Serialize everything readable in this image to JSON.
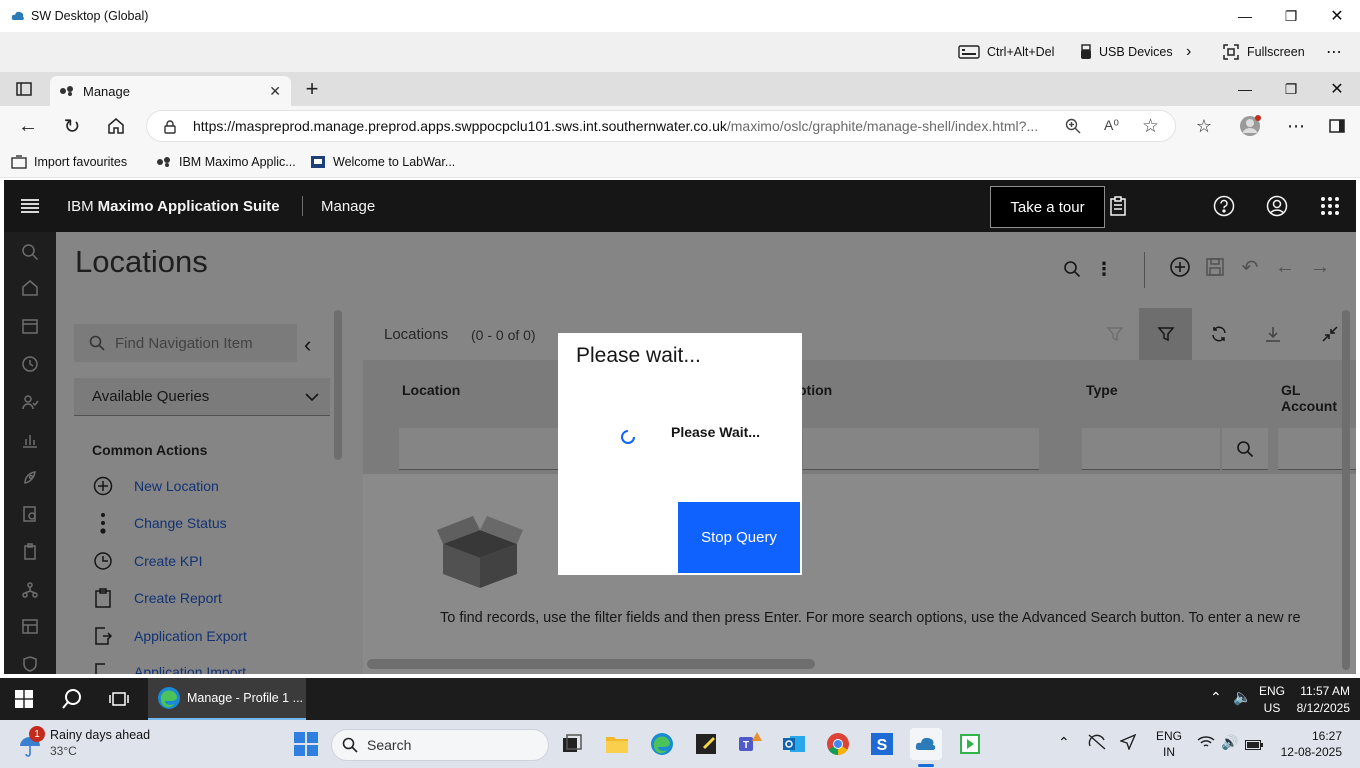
{
  "rdp_window": {
    "title": "SW Desktop (Global)",
    "toolbar": {
      "ctrl_alt_del": "Ctrl+Alt+Del",
      "usb_devices": "USB Devices",
      "fullscreen": "Fullscreen"
    }
  },
  "browser": {
    "tab_title": "Manage",
    "url_main": "https://maspreprod.manage.preprod.apps.swppocpclu101.sws.int.southernwater.co.uk",
    "url_path": "/maximo/oslc/graphite/manage-shell/index.html?...",
    "favorites": [
      "Import favourites",
      "IBM Maximo Applic...",
      "Welcome to LabWar..."
    ]
  },
  "maximo": {
    "brand_ibm": "IBM",
    "brand_name": "Maximo Application Suite",
    "product": "Manage",
    "tour_button": "Take a tour",
    "page_title": "Locations",
    "nav": {
      "search_placeholder": "Find Navigation Item",
      "queries_label": "Available Queries",
      "common_actions_heading": "Common Actions",
      "actions": [
        "New Location",
        "Change Status",
        "Create KPI",
        "Create Report",
        "Application Export",
        "Application Import"
      ]
    },
    "list": {
      "title": "Locations",
      "count": "(0 - 0 of 0)",
      "columns": {
        "location": "Location",
        "description": "ption",
        "type": "Type",
        "gl_account": "GL Account"
      },
      "empty_message": "To find records, use the filter fields and then press Enter. For more search options, use the Advanced Search button. To enter a new re"
    }
  },
  "dialog": {
    "title": "Please wait...",
    "message": "Please Wait...",
    "stop_button": "Stop Query"
  },
  "remote_taskbar": {
    "active_app": "Manage - Profile 1 ...",
    "lang_top": "ENG",
    "lang_bottom": "US",
    "time": "11:57 AM",
    "date": "8/12/2025"
  },
  "local_taskbar": {
    "weather_title": "Rainy days ahead",
    "weather_temp": "33°C",
    "weather_badge": "1",
    "search_label": "Search",
    "lang_top": "ENG",
    "lang_bottom": "IN",
    "time": "16:27",
    "date": "12-08-2025"
  },
  "colors": {
    "ibm_blue": "#0f62fe",
    "header_bg": "#161616",
    "link": "#0f4fcf"
  }
}
